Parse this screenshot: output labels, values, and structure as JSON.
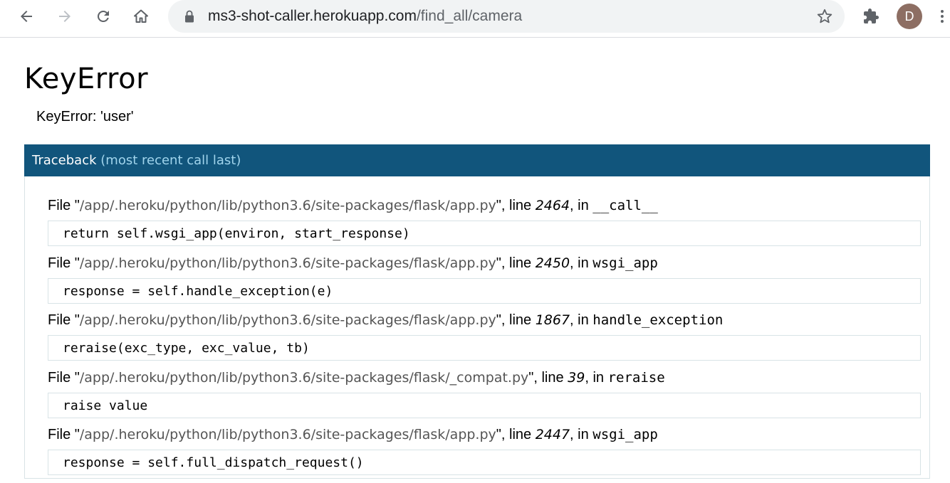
{
  "browser": {
    "url_host": "ms3-shot-caller.herokuapp.com",
    "url_path": "/find_all/camera",
    "profile_initial": "D"
  },
  "page": {
    "title": "KeyError",
    "message": "KeyError: 'user'",
    "traceback_title": "Traceback",
    "traceback_subtitle": "(most recent call last)"
  },
  "frames": [
    {
      "prefix": "File \"",
      "path": "/app/.heroku/python/lib/python3.6/site-packages/flask/app.py",
      "mid": "\", line ",
      "line": "2464",
      "in": ", in ",
      "func": "__call__",
      "code": "return self.wsgi_app(environ, start_response)"
    },
    {
      "prefix": "File \"",
      "path": "/app/.heroku/python/lib/python3.6/site-packages/flask/app.py",
      "mid": "\", line ",
      "line": "2450",
      "in": ", in ",
      "func": "wsgi_app",
      "code": "response = self.handle_exception(e)"
    },
    {
      "prefix": "File \"",
      "path": "/app/.heroku/python/lib/python3.6/site-packages/flask/app.py",
      "mid": "\", line ",
      "line": "1867",
      "in": ", in ",
      "func": "handle_exception",
      "code": "reraise(exc_type, exc_value, tb)"
    },
    {
      "prefix": "File \"",
      "path": "/app/.heroku/python/lib/python3.6/site-packages/flask/_compat.py",
      "mid": "\", line ",
      "line": "39",
      "in": ", in ",
      "func": "reraise",
      "code": "raise value"
    },
    {
      "prefix": "File \"",
      "path": "/app/.heroku/python/lib/python3.6/site-packages/flask/app.py",
      "mid": "\", line ",
      "line": "2447",
      "in": ", in ",
      "func": "wsgi_app",
      "code": "response = self.full_dispatch_request()"
    }
  ],
  "icons": {
    "back": "arrow-left-icon",
    "forward": "arrow-right-icon",
    "reload": "reload-icon",
    "home": "home-icon",
    "lock": "lock-icon",
    "bookmark": "star-icon",
    "extensions": "puzzle-icon",
    "menu": "kebab-menu-icon"
  },
  "colors": {
    "traceback_header_bg": "#11557c",
    "traceback_header_sub": "#a0d4ec",
    "file_path": "#555555",
    "avatar_bg": "#8d6e63"
  }
}
